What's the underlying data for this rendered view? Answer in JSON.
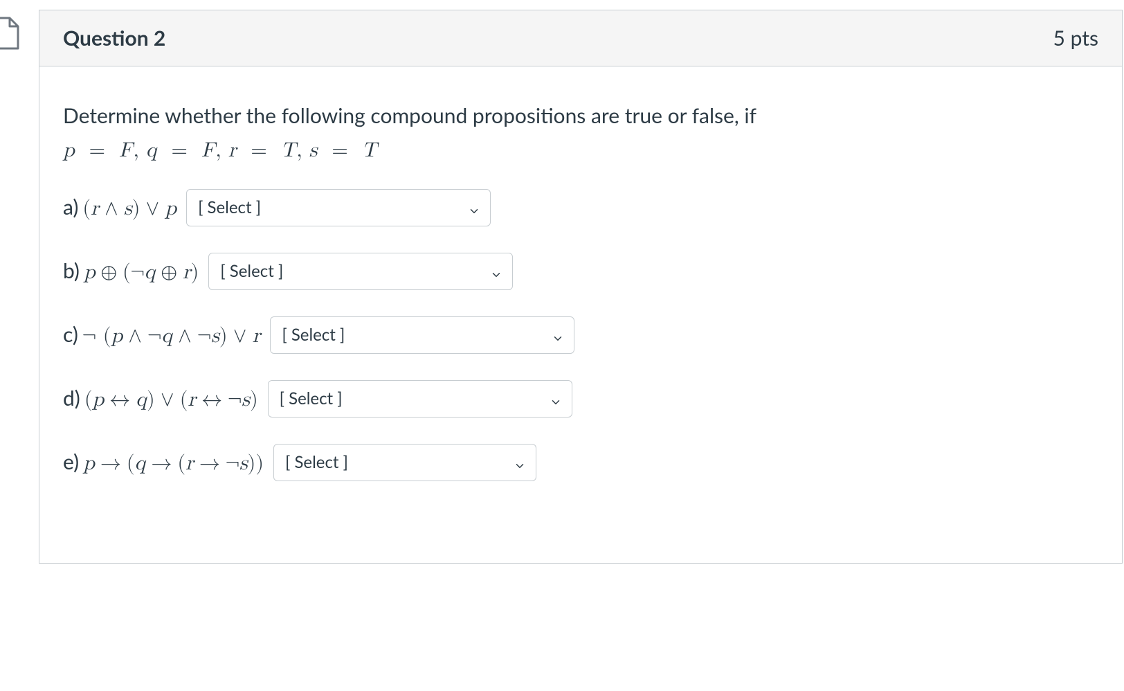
{
  "header": {
    "title": "Question 2",
    "points": "5 pts"
  },
  "prompt": "Determine whether the following compound propositions are true or false, if",
  "givens_html": "p  =   F,  q  =   F,  r  =  T,  s  =  T",
  "select_placeholder": "[ Select ]",
  "parts": {
    "a": {
      "label": "a)",
      "expr": "(r  ∧  s) ∨  p"
    },
    "b": {
      "label": "b)",
      "expr": "p  ⊕  (¬q  ⊕  r)"
    },
    "c": {
      "label": "c)",
      "expr": "¬ (p  ∧ ¬q  ∧ ¬s)  ∨  r"
    },
    "d": {
      "label": "d)",
      "expr": "(p  ↔  q)  ∨  (r  ↔  ¬s)"
    },
    "e": {
      "label": "e)",
      "expr": "p  →  (q  →  (r  →  ¬s))"
    }
  }
}
